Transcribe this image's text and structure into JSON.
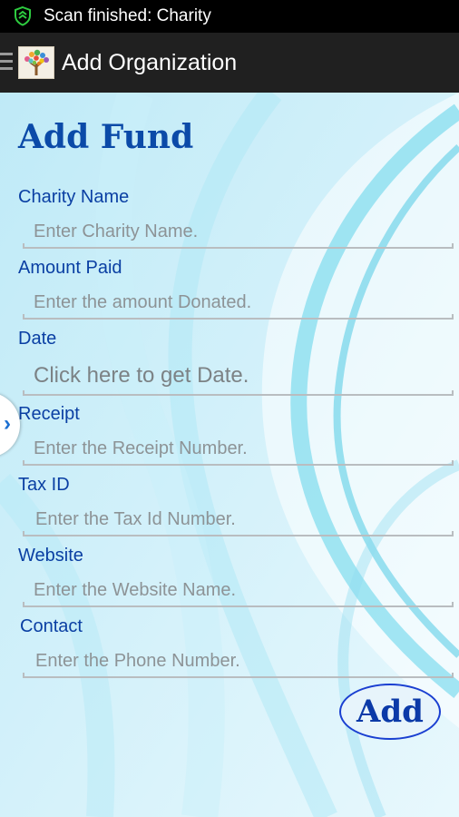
{
  "status_bar": {
    "notification_text": "Scan finished: Charity",
    "icon": "shield-icon"
  },
  "action_bar": {
    "title": "Add Organization",
    "menu_icon": "menu-icon",
    "logo": "app-logo"
  },
  "form": {
    "heading": "Add Fund",
    "fields": [
      {
        "label": "Charity Name",
        "placeholder": "Enter Charity Name.",
        "value": ""
      },
      {
        "label": "Amount Paid",
        "placeholder": "Enter the amount Donated.",
        "value": ""
      },
      {
        "label": "Date",
        "placeholder": "Click here to get Date.",
        "value": ""
      },
      {
        "label": "Receipt",
        "placeholder": "Enter the Receipt Number.",
        "value": ""
      },
      {
        "label": "Tax ID",
        "placeholder": "Enter the Tax Id Number.",
        "value": ""
      },
      {
        "label": "Website",
        "placeholder": "Enter the Website Name.",
        "value": ""
      },
      {
        "label": "Contact",
        "placeholder": "Enter the Phone Number.",
        "value": ""
      }
    ],
    "submit_label": "Add"
  },
  "side_tab": {
    "icon": "chevron-right-icon",
    "glyph": "›"
  },
  "colors": {
    "status_bar": "#000000",
    "action_bar": "#202020",
    "heading": "#0b4aa8",
    "label": "#0a3fa3",
    "placeholder": "#8d9396",
    "button_border": "#1a3fd1",
    "shield": "#2ecc40"
  }
}
